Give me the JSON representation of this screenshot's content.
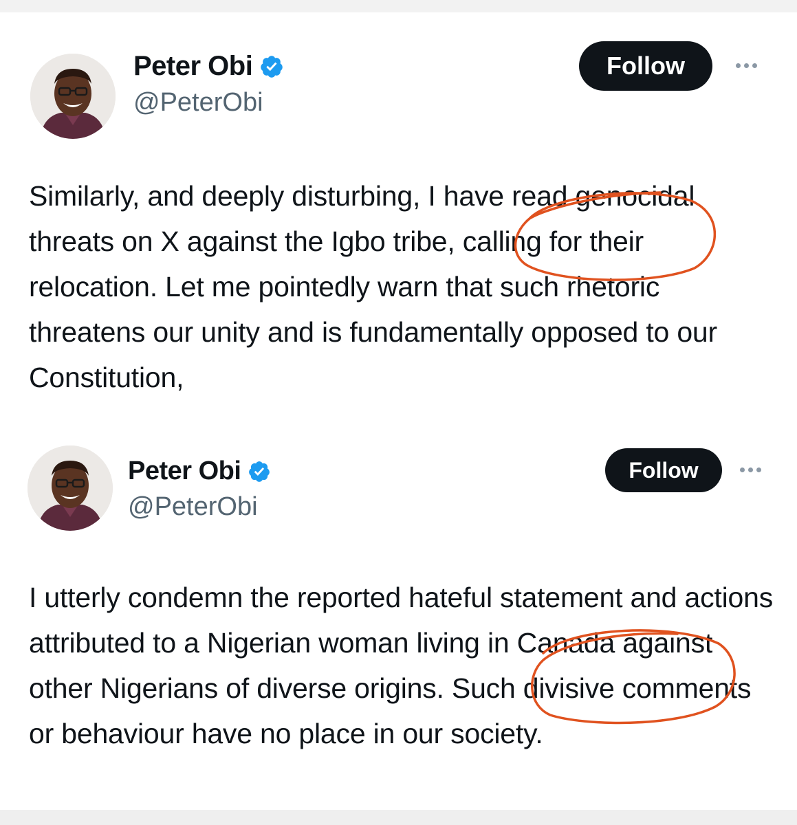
{
  "tweets": [
    {
      "author_name": "Peter Obi",
      "handle": "@PeterObi",
      "follow_label": "Follow",
      "text": "Similarly, and deeply disturbing, I have read genocidal threats on X against the Igbo tribe, calling for their relocation. Let me pointedly warn that such rhetoric threatens our unity and is fundamentally opposed to our Constitution,"
    },
    {
      "author_name": "Peter Obi",
      "handle": "@PeterObi",
      "follow_label": "Follow",
      "text": "I utterly condemn the reported hateful statement and actions attributed to a Nigerian woman living in Canada against other Nigerians of diverse origins. Such divisive comments or behaviour have no place in our society."
    }
  ],
  "icons": {
    "verified": "verified-badge-icon",
    "more": "more-options-icon"
  },
  "colors": {
    "verified_blue": "#1d9bf0",
    "annotation_red": "#e0521f",
    "follow_bg": "#0f1419",
    "handle_gray": "#536471"
  }
}
